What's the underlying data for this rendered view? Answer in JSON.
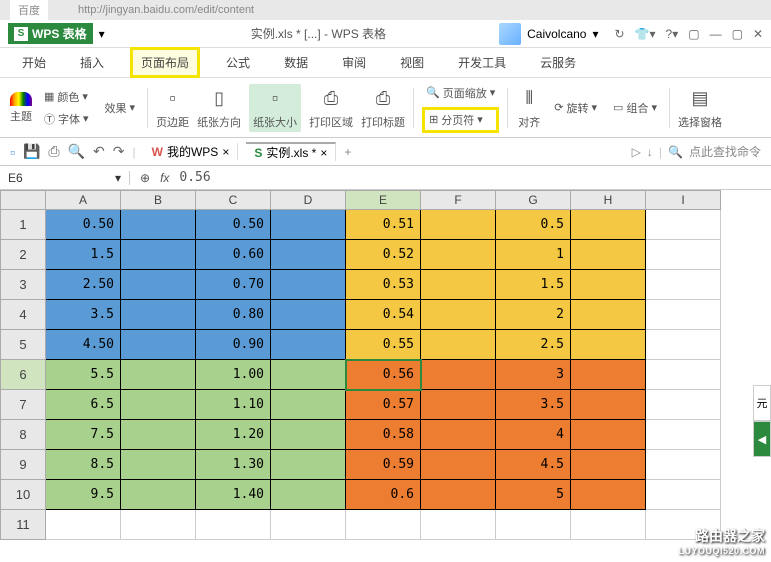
{
  "browser": {
    "tab": "百度",
    "url": "http://jingyan.baidu.com/edit/content"
  },
  "title": {
    "app": "WPS 表格",
    "doc": "实例.xls * [...] - WPS 表格",
    "user": "Caivolcano"
  },
  "menu": {
    "start": "开始",
    "insert": "插入",
    "layout": "页面布局",
    "formula": "公式",
    "data": "数据",
    "review": "审阅",
    "view": "视图",
    "dev": "开发工具",
    "cloud": "云服务"
  },
  "ribbon": {
    "theme": "主题",
    "font": "字体",
    "effect": "效果",
    "color": "颜色",
    "margin": "页边距",
    "orient": "纸张方向",
    "size": "纸张大小",
    "printarea": "打印区域",
    "printtitle": "打印标题",
    "zoom": "页面缩放",
    "breaks": "分页符",
    "align": "对齐",
    "rotate": "旋转",
    "group": "组合",
    "pane": "选择窗格"
  },
  "quickbar": {
    "mywps": "我的WPS",
    "doc": "实例.xls *",
    "search": "点此查找命令"
  },
  "formula": {
    "cellref": "E6",
    "fx": "fx",
    "value": "0.56"
  },
  "columns": [
    "A",
    "B",
    "C",
    "D",
    "E",
    "F",
    "G",
    "H",
    "I"
  ],
  "rows": [
    "1",
    "2",
    "3",
    "4",
    "5",
    "6",
    "7",
    "8",
    "9",
    "10",
    "11"
  ],
  "grid": [
    [
      "0.50",
      "",
      "0.50",
      "",
      "0.51",
      "",
      "0.5",
      "",
      ""
    ],
    [
      "1.5",
      "",
      "0.60",
      "",
      "0.52",
      "",
      "1",
      "",
      ""
    ],
    [
      "2.50",
      "",
      "0.70",
      "",
      "0.53",
      "",
      "1.5",
      "",
      ""
    ],
    [
      "3.5",
      "",
      "0.80",
      "",
      "0.54",
      "",
      "2",
      "",
      ""
    ],
    [
      "4.50",
      "",
      "0.90",
      "",
      "0.55",
      "",
      "2.5",
      "",
      ""
    ],
    [
      "5.5",
      "",
      "1.00",
      "",
      "0.56",
      "",
      "3",
      "",
      ""
    ],
    [
      "6.5",
      "",
      "1.10",
      "",
      "0.57",
      "",
      "3.5",
      "",
      ""
    ],
    [
      "7.5",
      "",
      "1.20",
      "",
      "0.58",
      "",
      "4",
      "",
      ""
    ],
    [
      "8.5",
      "",
      "1.30",
      "",
      "0.59",
      "",
      "4.5",
      "",
      ""
    ],
    [
      "9.5",
      "",
      "1.40",
      "",
      "0.6",
      "",
      "5",
      "",
      ""
    ],
    [
      "",
      "",
      "",
      "",
      "",
      "",
      "",
      "",
      ""
    ]
  ],
  "watermark": {
    "main": "路由器之家",
    "sub": "LUYOUQI520.COM"
  },
  "strip": {
    "label": "元"
  }
}
